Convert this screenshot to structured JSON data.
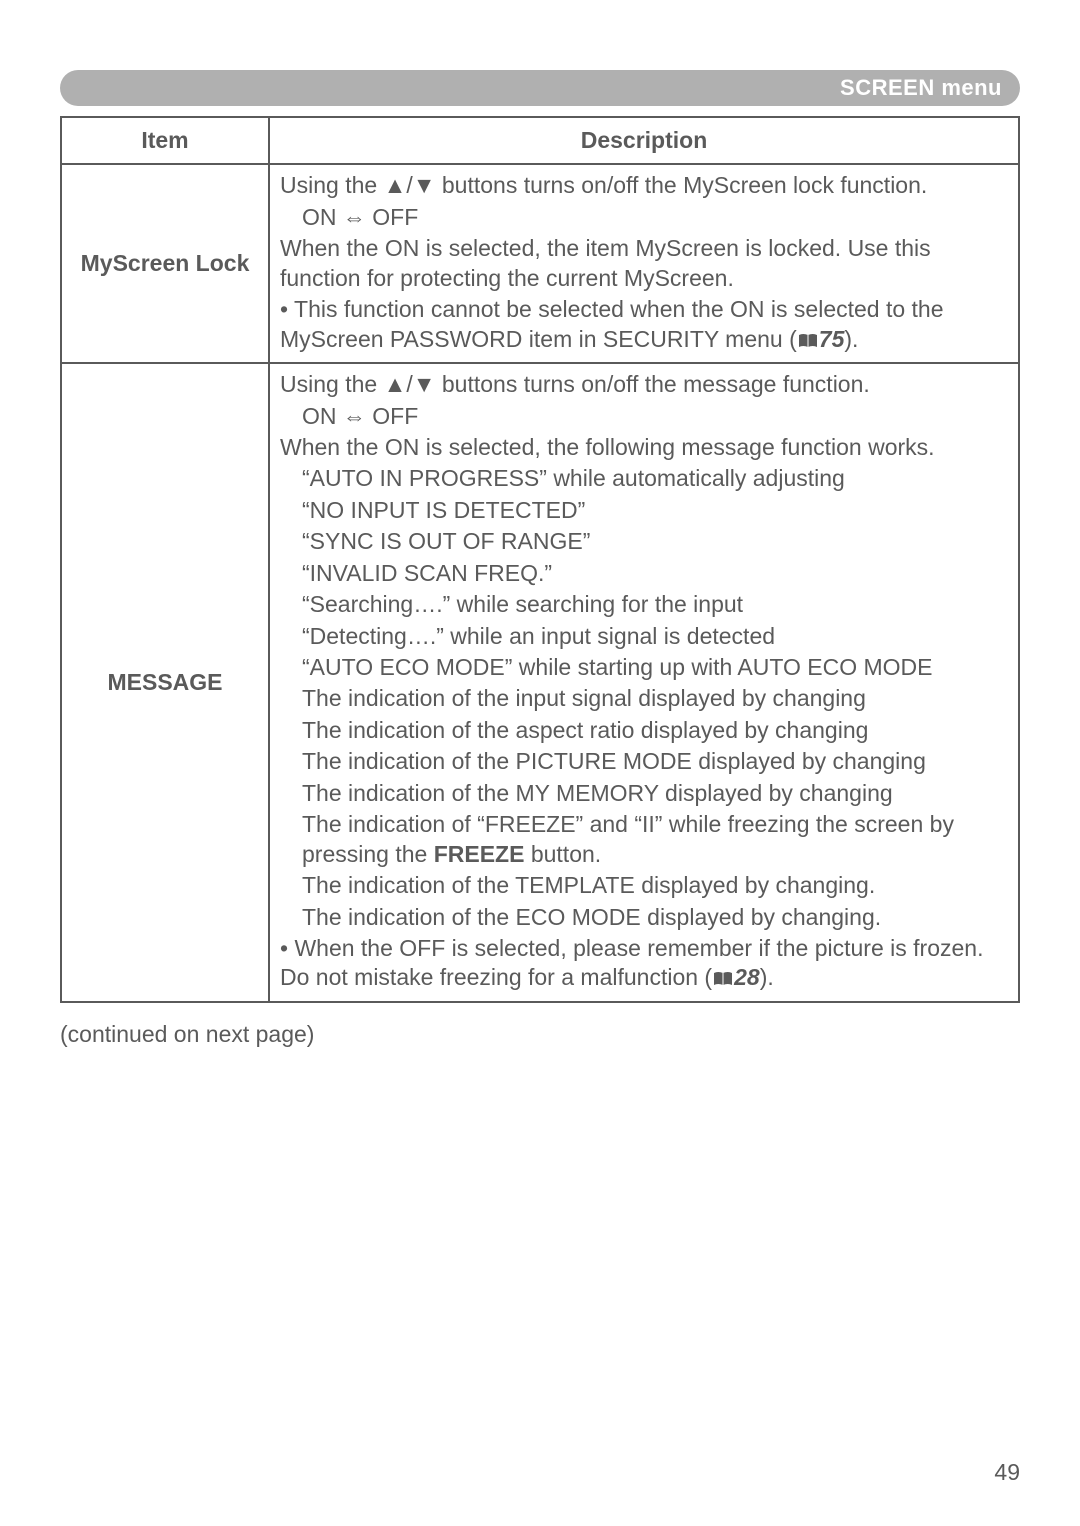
{
  "header": {
    "title": "SCREEN menu"
  },
  "table": {
    "headers": {
      "item": "Item",
      "description": "Description"
    },
    "rows": {
      "r0": {
        "item": "MyScreen Lock",
        "p1a": "Using the ",
        "p1b": "▲/▼",
        "p1c": " buttons turns on/off the MyScreen lock function.",
        "toggle_on": "ON ",
        "toggle_arrow": "⇔",
        "toggle_off": " OFF",
        "p2": "When the ON is selected, the item MyScreen is locked. Use this function for protecting the current MyScreen.",
        "p3a": "• This function cannot be selected when the ON is selected to the MyScreen PASSWORD item in SECURITY menu (",
        "ref1": "75",
        "p3b": ")."
      },
      "r1": {
        "item": "MESSAGE",
        "p1a": "Using the ",
        "p1b": "▲/▼",
        "p1c": " buttons turns on/off the message function.",
        "toggle_on": "ON ",
        "toggle_arrow": "⇔",
        "toggle_off": " OFF",
        "p2": "When the ON is selected, the following message function works.",
        "l0": "“AUTO IN PROGRESS” while automatically adjusting",
        "l1": "“NO INPUT IS DETECTED”",
        "l2": "“SYNC IS OUT OF RANGE”",
        "l3": "“INVALID SCAN FREQ.”",
        "l4": "“Searching….” while searching for the input",
        "l5": "“Detecting….” while an input signal is detected",
        "l6": "“AUTO ECO MODE” while starting up with AUTO ECO MODE",
        "l7": "The indication of the input signal displayed by changing",
        "l8": "The indication of the aspect ratio displayed by changing",
        "l9": "The indication of the PICTURE MODE displayed by changing",
        "l10": "The indication of the MY MEMORY displayed by changing",
        "l11a": "The indication of “FREEZE” and “II” while freezing the screen by pressing the ",
        "l11b": "FREEZE",
        "l11c": " button.",
        "l12": "The indication of the TEMPLATE displayed by changing.",
        "l13": "The indication of the ECO MODE displayed by changing.",
        "p3a": "• When the OFF is selected, please remember if the picture is frozen. Do not mistake freezing for a malfunction (",
        "ref1": "28",
        "p3b": ")."
      }
    }
  },
  "continued": "(continued on next page)",
  "page_number": "49"
}
